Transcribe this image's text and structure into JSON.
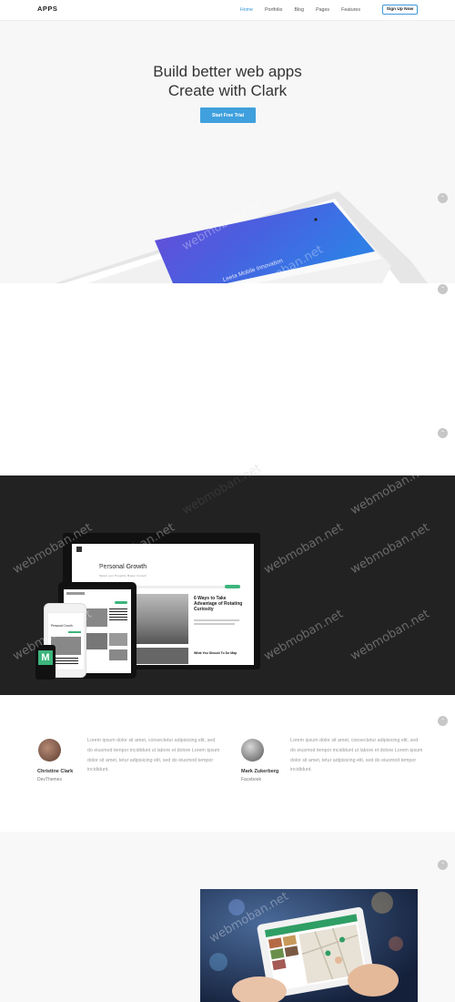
{
  "nav": {
    "logo": "APPS",
    "items": [
      {
        "label": "Home",
        "active": true
      },
      {
        "label": "Portfolio"
      },
      {
        "label": "Blog"
      },
      {
        "label": "Pages"
      },
      {
        "label": "Features"
      }
    ],
    "cta": "Sign Up Now"
  },
  "hero": {
    "title_line1": "Build better web apps",
    "title_line2": "Create with Clark",
    "button": "Start Free Trial",
    "tablet_text": "Leeta Mobile Innovation"
  },
  "showcase": {
    "laptop_title": "Personal Growth",
    "laptop_sub": "Master your Thoughts, Master Yourself",
    "article_title": "6 Ways to Take Advantage of Rotating Curiosity",
    "article_title2": "What You Should To Do Map"
  },
  "testimonials": [
    {
      "name": "Christine Clark",
      "company": "DevThemes",
      "quote": "Lorem ipsum dolor sit amet, consectetur adipisicing elit, sed do eiusmod tempor incididunt ut labore et dolore Lorem ipsum dolor sit amet, tetur adipisicing elit, sed do eiusmod tempor incididunt."
    },
    {
      "name": "Mark Zukerberg",
      "company": "Facebook",
      "quote": "Lorem ipsum dolor sit amet, consectetur adipisicing elit, sed do eiusmod tempor incididunt ut labore et dolore Lorem ipsum dolor sit amet, tetur adipisicing elit, sed do eiusmod tempor incididunt."
    }
  ],
  "watermark": "webmoban.net",
  "colors": {
    "accent": "#3b9ad9",
    "dark_section": "#222222",
    "hero_bg": "#f7f7f7"
  }
}
